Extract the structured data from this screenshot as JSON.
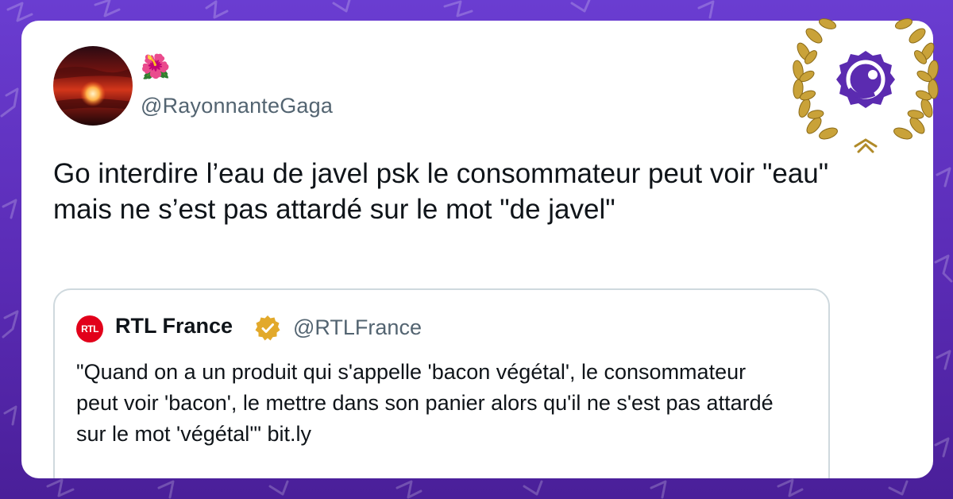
{
  "tweet": {
    "author_name": "🌺",
    "handle": "@RayonnanteGaga",
    "text": "Go interdire l’eau de javel psk le consommateur peut voir \"eau\" mais ne s’est pas attardé sur le mot \"de javel\""
  },
  "quoted": {
    "logo_text": "RTL",
    "name": "RTL France",
    "handle": "@RTLFrance",
    "text": "\"Quand on a un produit qui s'appelle 'bacon végétal', le consommateur peut voir 'bacon', le mettre dans son panier alors qu'il ne s'est pas attardé sur le mot 'végétal'\" bit.ly"
  },
  "colors": {
    "background": "#5b2fb8",
    "verified_badge": "#e2a92b",
    "rtl_logo": "#e2001a",
    "badge_logo": "#5b2bb0",
    "laurel": "#c9a239"
  },
  "icons": {
    "verified": "verified-badge-icon",
    "award": "laurel-award-icon"
  }
}
